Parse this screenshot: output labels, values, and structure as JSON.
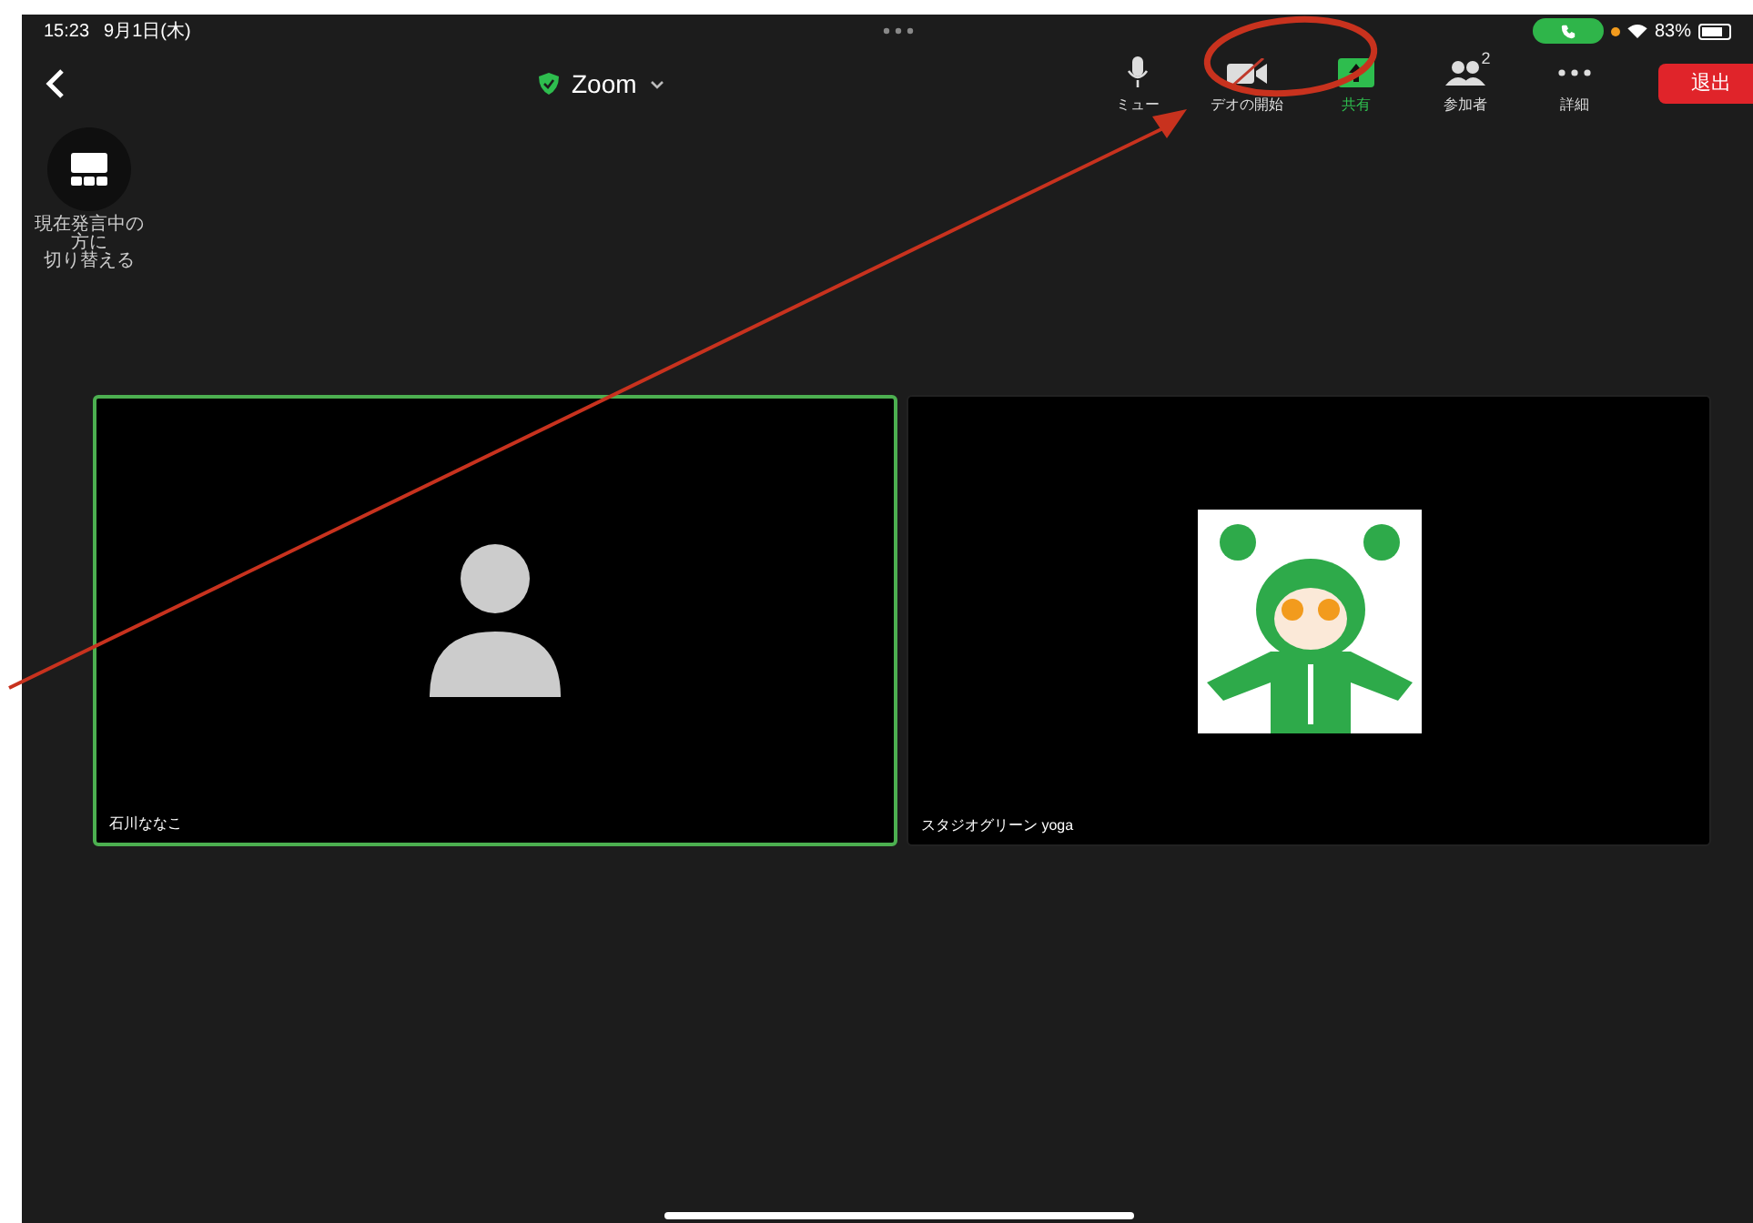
{
  "status_bar": {
    "time": "15:23",
    "date": "9月1日(木)",
    "battery": "83%"
  },
  "toolbar": {
    "title": "Zoom",
    "buttons": [
      {
        "kind": "mic",
        "label": "ミュー"
      },
      {
        "kind": "video",
        "label": "デオの開始"
      },
      {
        "kind": "share",
        "label": "共有"
      },
      {
        "kind": "participants",
        "label": "参加者",
        "count": "2"
      },
      {
        "kind": "more",
        "label": "詳細"
      }
    ],
    "leave": "退出"
  },
  "speaker_view": {
    "lines": [
      "現在発言中の",
      "方に",
      "切り替える"
    ]
  },
  "tiles": [
    {
      "kind": "avatar",
      "name": "石川ななこ",
      "selected": true
    },
    {
      "kind": "picture",
      "name": "スタジオグリーン yoga",
      "selected": false
    }
  ]
}
